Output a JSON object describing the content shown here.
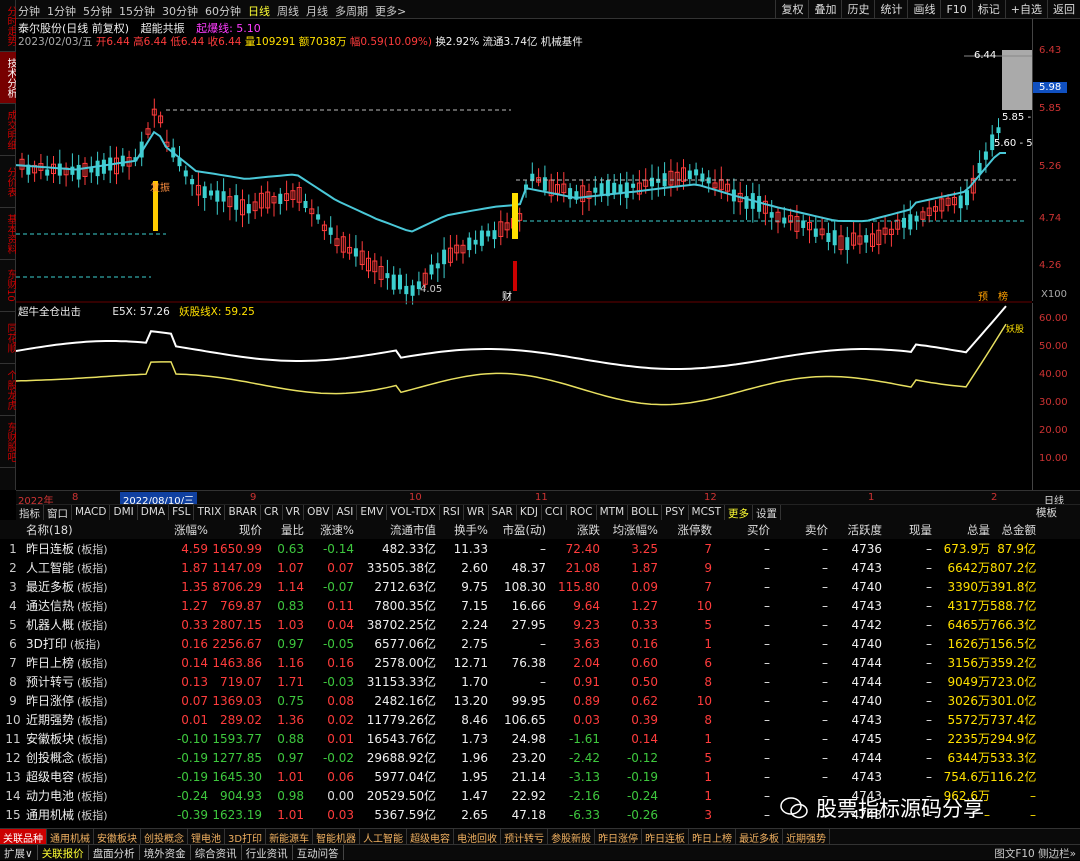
{
  "left_tabs": [
    "分时走势",
    "技术分析",
    "成交明细",
    "分价表",
    "基本资料",
    "东财10",
    "同花顺",
    "个股龙虎",
    "东财股吧"
  ],
  "periods": [
    "分钟",
    "1分钟",
    "5分钟",
    "15分钟",
    "30分钟",
    "60分钟",
    "日线",
    "周线",
    "月线",
    "多周期",
    "更多>"
  ],
  "active_period": "日线",
  "top_buttons": [
    "复权",
    "叠加",
    "历史",
    "统计",
    "画线",
    "F10",
    "标记",
    "+自选",
    "返回"
  ],
  "info": {
    "name": "泰尔股份(日线 前复权)",
    "ind1": "超能共振",
    "ind2": "起爆线: 5.10"
  },
  "quote": {
    "date": "2023/02/03/五",
    "open": "开6.44",
    "high": "高6.44",
    "low": "低6.44",
    "close": "收6.44",
    "vol": "量109291",
    "amt": "额7038万",
    "chg": "幅0.59(10.09%)",
    "turn": "换2.92%",
    "float": "流通3.74亿",
    "sector": "机械基件"
  },
  "price_labels": {
    "p1": "6.43",
    "p2": "5.85",
    "p3": "5.26",
    "p4": "4.74",
    "p5": "4.26",
    "current": "5.98",
    "hi_mark": "6.44",
    "box1": "5.85 -",
    "box2": "5.60 - 5.",
    "low_mark": "4.05",
    "zoom": "X100",
    "yu": "预",
    "bang": "榜",
    "cai": "财",
    "fa": "发振"
  },
  "indicator": {
    "name": "超牛全仓出击",
    "e5": "E5X: 57.26",
    "yao": "妖股线X: 59.25",
    "l60": "60.00",
    "l50": "50.00",
    "l40": "40.00",
    "l30": "30.00",
    "l20": "20.00",
    "l10": "10.00",
    "tag": "妖股"
  },
  "dates": {
    "year": "2022年",
    "t8": "8",
    "sel": "2022/08/10/三",
    "t9": "9",
    "t10": "10",
    "t11": "11",
    "t12": "12",
    "t1": "1",
    "t2": "2",
    "line": "日线"
  },
  "ind_tabs": [
    "指标",
    "窗口",
    "MACD",
    "DMI",
    "DMA",
    "FSL",
    "TRIX",
    "BRAR",
    "CR",
    "VR",
    "OBV",
    "ASI",
    "EMV",
    "VOL-TDX",
    "RSI",
    "WR",
    "SAR",
    "KDJ",
    "CCI",
    "ROC",
    "MTM",
    "BOLL",
    "PSY",
    "MCST",
    "更多",
    "设置"
  ],
  "template_btn": "模板",
  "columns": [
    "",
    "名称(18)",
    "涨幅%",
    "现价",
    "量比",
    "涨速%",
    "流通市值",
    "换手%",
    "市盈(动)",
    "涨跌",
    "均涨幅%",
    "涨停数",
    "买价",
    "卖价",
    "活跃度",
    "现量",
    "总量",
    "总金额"
  ],
  "rows": [
    [
      "1",
      "昨日连板",
      "4.59",
      "1650.99",
      "0.63",
      "-0.14",
      "482.33亿",
      "11.33",
      "–",
      "72.40",
      "3.25",
      "7",
      "–",
      "–",
      "4736",
      "–",
      "673.9万",
      "87.9亿"
    ],
    [
      "2",
      "人工智能",
      "1.87",
      "1147.09",
      "1.07",
      "0.07",
      "33505.38亿",
      "2.60",
      "48.37",
      "21.08",
      "1.87",
      "9",
      "–",
      "–",
      "4743",
      "–",
      "6642万",
      "807.2亿"
    ],
    [
      "3",
      "最近多板",
      "1.35",
      "8706.29",
      "1.14",
      "-0.07",
      "2712.63亿",
      "9.75",
      "108.30",
      "115.80",
      "0.09",
      "7",
      "–",
      "–",
      "4740",
      "–",
      "3390万",
      "391.8亿"
    ],
    [
      "4",
      "通达信热",
      "1.27",
      "769.87",
      "0.83",
      "0.11",
      "7800.35亿",
      "7.15",
      "16.66",
      "9.64",
      "1.27",
      "10",
      "–",
      "–",
      "4743",
      "–",
      "4317万",
      "588.7亿"
    ],
    [
      "5",
      "机器人概",
      "0.33",
      "2807.15",
      "1.03",
      "0.04",
      "38702.25亿",
      "2.24",
      "27.95",
      "9.23",
      "0.33",
      "5",
      "–",
      "–",
      "4742",
      "–",
      "6465万",
      "766.3亿"
    ],
    [
      "6",
      "3D打印",
      "0.16",
      "2256.67",
      "0.97",
      "-0.05",
      "6577.06亿",
      "2.75",
      "–",
      "3.63",
      "0.16",
      "1",
      "–",
      "–",
      "4740",
      "–",
      "1626万",
      "156.5亿"
    ],
    [
      "7",
      "昨日上榜",
      "0.14",
      "1463.86",
      "1.16",
      "0.16",
      "2578.00亿",
      "12.71",
      "76.38",
      "2.04",
      "0.60",
      "6",
      "–",
      "–",
      "4744",
      "–",
      "3156万",
      "359.2亿"
    ],
    [
      "8",
      "预计转亏",
      "0.13",
      "719.07",
      "1.71",
      "-0.03",
      "31153.33亿",
      "1.70",
      "–",
      "0.91",
      "0.50",
      "8",
      "–",
      "–",
      "4744",
      "–",
      "9049万",
      "723.0亿"
    ],
    [
      "9",
      "昨日涨停",
      "0.07",
      "1369.03",
      "0.75",
      "0.08",
      "2482.16亿",
      "13.20",
      "99.95",
      "0.89",
      "0.62",
      "10",
      "–",
      "–",
      "4740",
      "–",
      "3026万",
      "301.0亿"
    ],
    [
      "10",
      "近期强势",
      "0.01",
      "289.02",
      "1.36",
      "0.02",
      "11779.26亿",
      "8.46",
      "106.65",
      "0.03",
      "0.39",
      "8",
      "–",
      "–",
      "4743",
      "–",
      "5572万",
      "737.4亿"
    ],
    [
      "11",
      "安徽板块",
      "-0.10",
      "1593.77",
      "0.88",
      "0.01",
      "16543.76亿",
      "1.73",
      "24.98",
      "-1.61",
      "0.14",
      "1",
      "–",
      "–",
      "4745",
      "–",
      "2235万",
      "294.9亿"
    ],
    [
      "12",
      "创投概念",
      "-0.19",
      "1277.85",
      "0.97",
      "-0.02",
      "29688.92亿",
      "1.96",
      "23.20",
      "-2.42",
      "-0.12",
      "5",
      "–",
      "–",
      "4744",
      "–",
      "6344万",
      "533.3亿"
    ],
    [
      "13",
      "超级电容",
      "-0.19",
      "1645.30",
      "1.01",
      "0.06",
      "5977.04亿",
      "1.95",
      "21.14",
      "-3.13",
      "-0.19",
      "1",
      "–",
      "–",
      "4743",
      "–",
      "754.6万",
      "116.2亿"
    ],
    [
      "14",
      "动力电池",
      "-0.24",
      "904.93",
      "0.98",
      "0.00",
      "20529.50亿",
      "1.47",
      "22.92",
      "-2.16",
      "-0.24",
      "1",
      "–",
      "–",
      "4743",
      "–",
      "962.6万",
      "–"
    ],
    [
      "15",
      "通用机械",
      "-0.39",
      "1623.19",
      "1.01",
      "0.03",
      "5367.59亿",
      "2.65",
      "47.18",
      "-6.33",
      "-0.26",
      "3",
      "–",
      "–",
      "4743",
      "–",
      "–",
      "–"
    ]
  ],
  "row_tag": "(板指)",
  "watermark": "股票指标源码分享",
  "sector_tabs": [
    "关联品种",
    "通用机械",
    "安徽板块",
    "创投概念",
    "锂电池",
    "3D打印",
    "新能源车",
    "智能机器",
    "人工智能",
    "超级电容",
    "电池回收",
    "预计转亏",
    "参股新股",
    "昨日涨停",
    "昨日连板",
    "昨日上榜",
    "最近多板",
    "近期强势"
  ],
  "status_tabs": [
    "扩展∨",
    "关联报价",
    "盘面分析",
    "境外资金",
    "综合资讯",
    "行业资讯",
    "互动问答"
  ],
  "status_right": "图文F10 侧边栏»"
}
